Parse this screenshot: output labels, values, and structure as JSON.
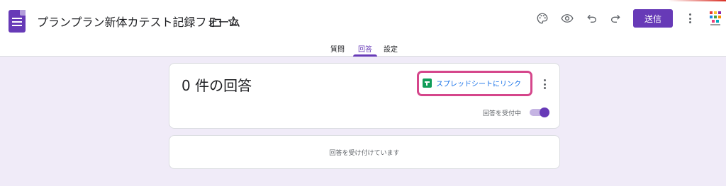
{
  "header": {
    "form_title": "プランプラン新体カテスト記録フォーム",
    "send_label": "送信",
    "accent_color": "#673ab7"
  },
  "tabs": [
    {
      "label": "質問",
      "active": false
    },
    {
      "label": "回答",
      "active": true
    },
    {
      "label": "設定",
      "active": false
    }
  ],
  "responses": {
    "count_title": "0 件の回答",
    "sheets_link_label": "スプレッドシートにリンク",
    "accepting_label": "回答を受付中",
    "accepting": true,
    "status_message": "回答を受け付けています"
  },
  "icons": {
    "app": "google-forms-icon",
    "folder": "folder-icon",
    "star": "star-icon",
    "palette": "palette-icon",
    "preview": "eye-icon",
    "undo": "undo-icon",
    "redo": "redo-icon",
    "more": "more-vert-icon",
    "sheets": "sheets-icon"
  }
}
